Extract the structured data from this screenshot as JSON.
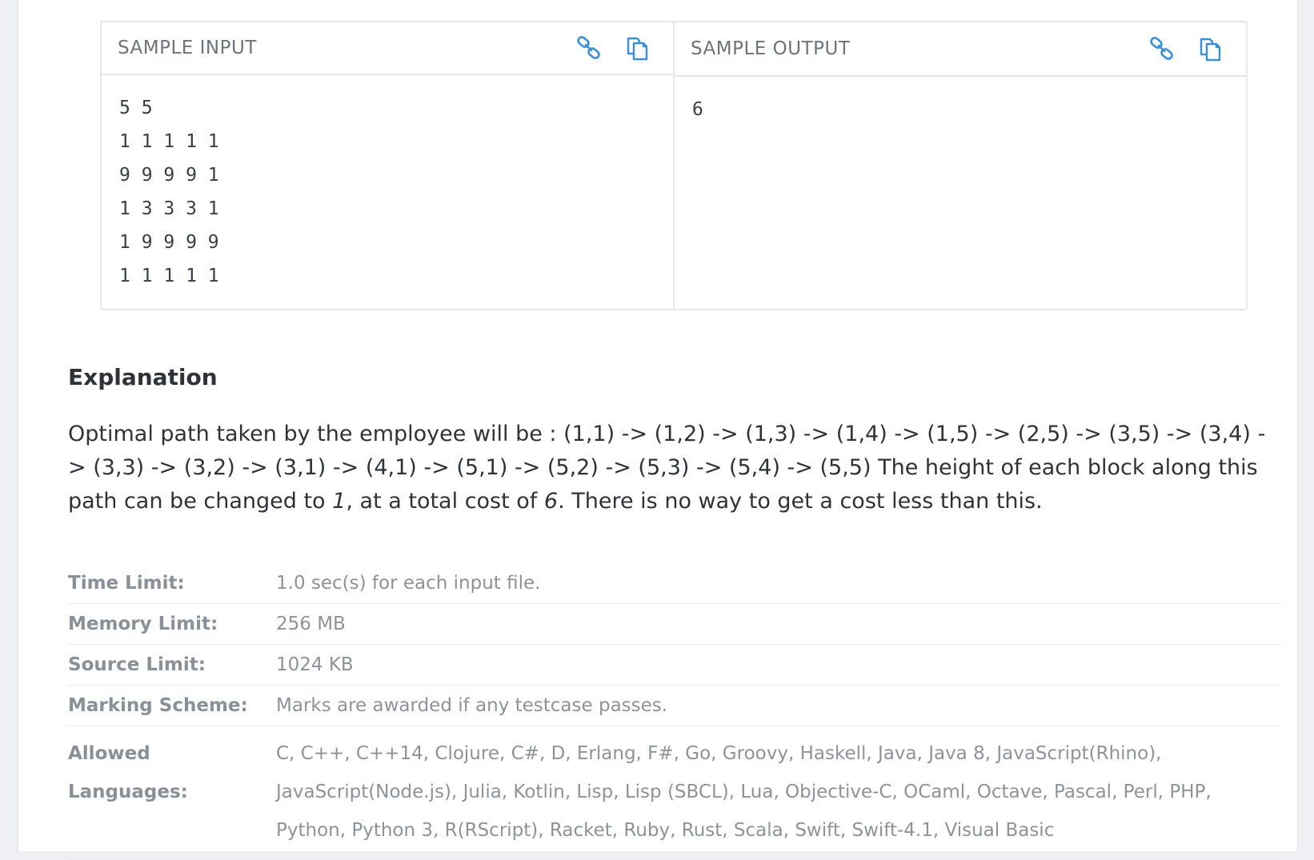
{
  "sample_input": {
    "title": "SAMPLE INPUT",
    "lines": [
      "5 5",
      "1 1 1 1 1",
      "9 9 9 9 1",
      "1 3 3 3 1",
      "1 9 9 9 9",
      "1 1 1 1 1"
    ]
  },
  "sample_output": {
    "title": "SAMPLE OUTPUT",
    "lines": [
      "6"
    ]
  },
  "explanation": {
    "title": "Explanation",
    "text_before": "Optimal path taken by the employee will be : (1,1) -> (1,2) -> (1,3) -> (1,4) -> (1,5) -> (2,5) -> (3,5) -> (3,4) -> (3,3) -> (3,2) -> (3,1) -> (4,1) -> (5,1) -> (5,2) -> (5,3) -> (5,4) -> (5,5) The height of each block along this path can be changed to ",
    "emph1": "1",
    "text_mid": ", at a total cost of ",
    "emph2": "6",
    "text_after": ". There is no way to get a cost less than this."
  },
  "limits": [
    {
      "label": "Time Limit:",
      "value": "1.0 sec(s) for each input file."
    },
    {
      "label": "Memory Limit:",
      "value": "256 MB"
    },
    {
      "label": "Source Limit:",
      "value": "1024 KB"
    },
    {
      "label": "Marking Scheme:",
      "value": "Marks are awarded if any testcase passes."
    },
    {
      "label": "Allowed Languages:",
      "value": "C, C++, C++14, Clojure, C#, D, Erlang, F#, Go, Groovy, Haskell, Java, Java 8, JavaScript(Rhino), JavaScript(Node.js), Julia, Kotlin, Lisp, Lisp (SBCL), Lua, Objective-C, OCaml, Octave, Pascal, Perl, PHP, Python, Python 3, R(RScript), Racket, Ruby, Rust, Scala, Swift, Swift-4.1, Visual Basic"
    }
  ],
  "icons": {
    "link": "link-icon",
    "copy": "copy-icon"
  },
  "colors": {
    "icon_blue": "#3b8fd6",
    "label_gray": "#8a9098",
    "text_dark": "#2f3339"
  }
}
